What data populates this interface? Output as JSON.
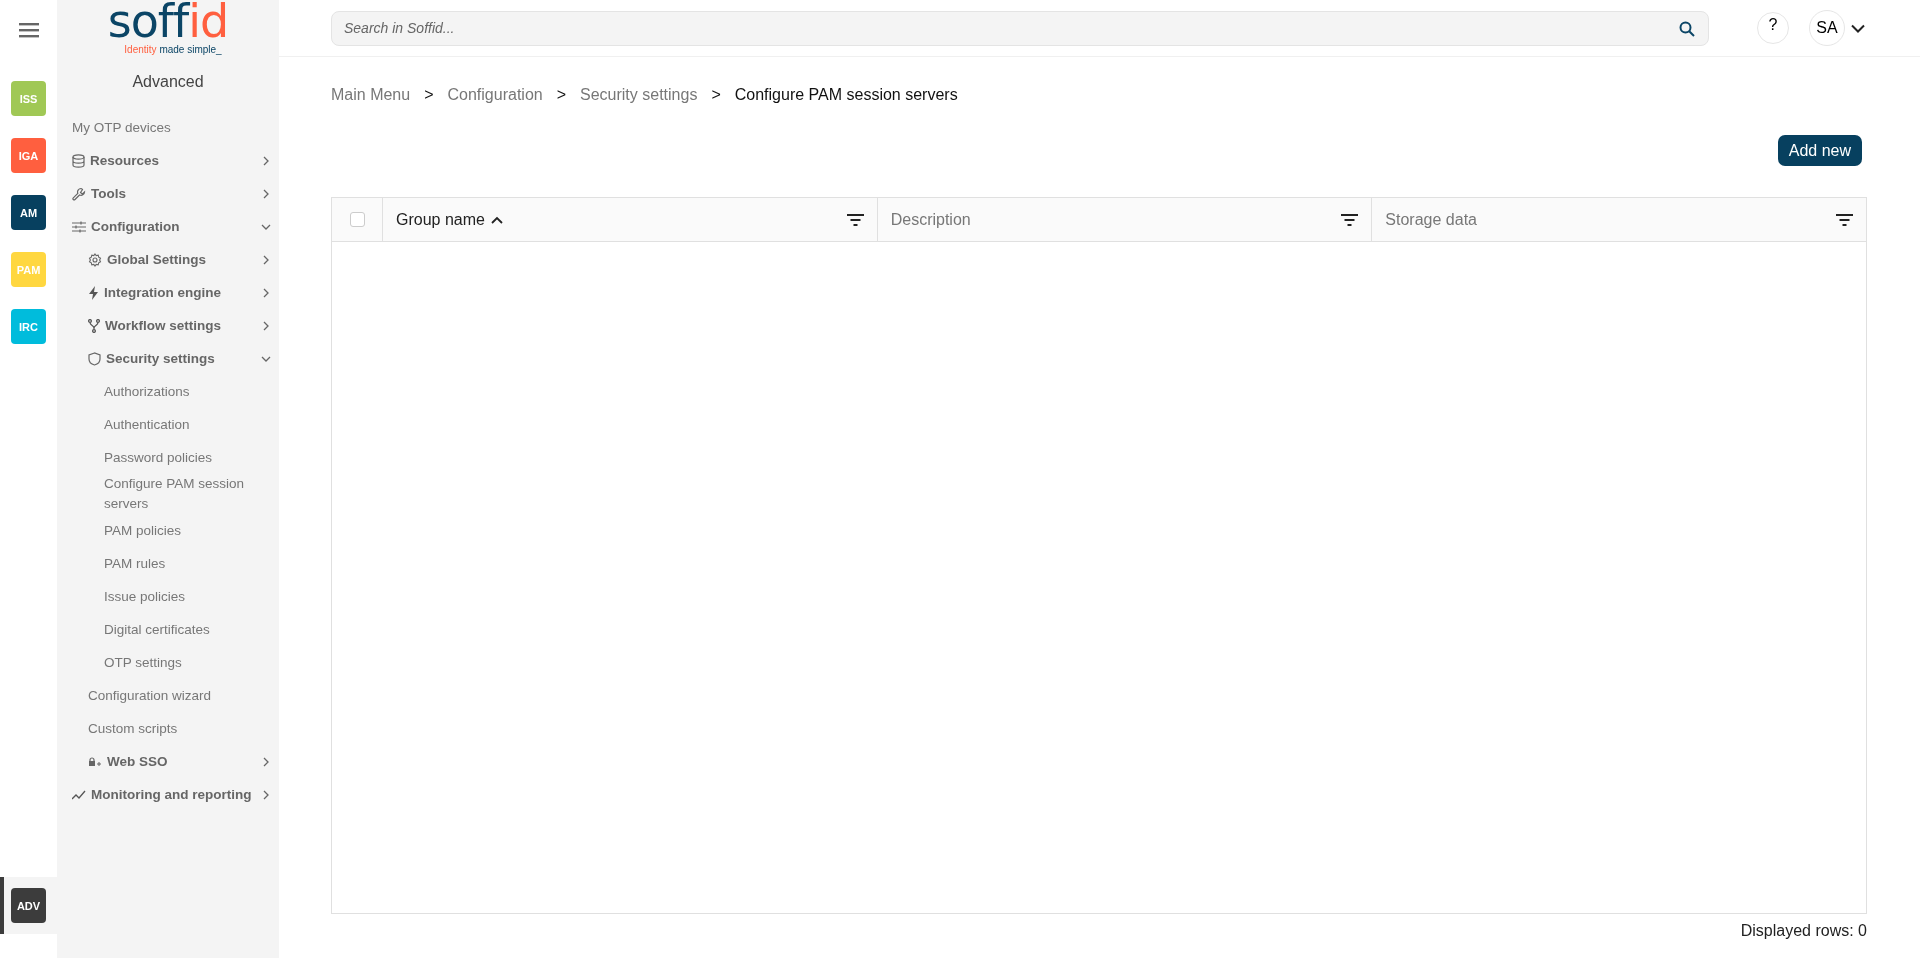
{
  "rail": {
    "items": [
      {
        "label": "ISS",
        "color": "#a0c855",
        "selected": false
      },
      {
        "label": "IGA",
        "color": "#ff5f3f",
        "selected": false
      },
      {
        "label": "AM",
        "color": "#07405f",
        "selected": false
      },
      {
        "label": "PAM",
        "color": "#ffd740",
        "selected": false
      },
      {
        "label": "IRC",
        "color": "#00bcdc",
        "selected": false
      }
    ],
    "bottom_item": {
      "label": "ADV",
      "color": "#3c3c3c",
      "selected": true
    }
  },
  "logo": {
    "brand_parts": [
      "soff",
      "id"
    ],
    "tagline_parts": [
      "Identity",
      "made simple_"
    ]
  },
  "sidebar": {
    "title": "Advanced",
    "items": [
      {
        "kind": "link",
        "label": "My OTP devices"
      },
      {
        "kind": "group",
        "label": "Resources",
        "expanded": false
      },
      {
        "kind": "group",
        "label": "Tools",
        "expanded": false
      },
      {
        "kind": "group",
        "label": "Configuration",
        "expanded": true,
        "children": [
          {
            "kind": "group",
            "label": "Global Settings",
            "expanded": false
          },
          {
            "kind": "group",
            "label": "Integration engine",
            "expanded": false
          },
          {
            "kind": "group",
            "label": "Workflow settings",
            "expanded": false
          },
          {
            "kind": "group",
            "label": "Security settings",
            "expanded": true,
            "children": [
              {
                "kind": "link",
                "label": "Authorizations"
              },
              {
                "kind": "link",
                "label": "Authentication"
              },
              {
                "kind": "link",
                "label": "Password policies"
              },
              {
                "kind": "link",
                "label": "Configure PAM session servers"
              },
              {
                "kind": "link",
                "label": "PAM policies"
              },
              {
                "kind": "link",
                "label": "PAM rules"
              },
              {
                "kind": "link",
                "label": "Issue policies"
              },
              {
                "kind": "link",
                "label": "Digital certificates"
              },
              {
                "kind": "link",
                "label": "OTP settings"
              }
            ]
          },
          {
            "kind": "link",
            "label": "Configuration wizard"
          },
          {
            "kind": "link",
            "label": "Custom scripts"
          },
          {
            "kind": "group",
            "label": "Web SSO",
            "expanded": false
          }
        ]
      },
      {
        "kind": "group",
        "label": "Monitoring and reporting",
        "expanded": false
      }
    ]
  },
  "search": {
    "placeholder": "Search in Soffid..."
  },
  "help": {
    "label": "?"
  },
  "user": {
    "initials": "SA"
  },
  "breadcrumb": [
    {
      "kind": "link",
      "text": "Main Menu"
    },
    {
      "kind": "separator",
      "text": ">"
    },
    {
      "kind": "link",
      "text": "Configuration"
    },
    {
      "kind": "separator",
      "text": ">"
    },
    {
      "kind": "link",
      "text": "Security settings"
    },
    {
      "kind": "separator",
      "text": ">"
    },
    {
      "kind": "current",
      "text": "Configure PAM session servers"
    }
  ],
  "add_button": {
    "label": "Add new"
  },
  "table": {
    "select_all": {
      "checked": false
    },
    "columns": [
      {
        "label": "Group name",
        "sorted": true,
        "filter": true
      },
      {
        "label": "Description",
        "sorted": false,
        "filter": true
      },
      {
        "label": "Storage data",
        "sorted": false,
        "filter": true
      }
    ]
  },
  "footer": {
    "displayed_rows": "Displayed rows: 0"
  }
}
